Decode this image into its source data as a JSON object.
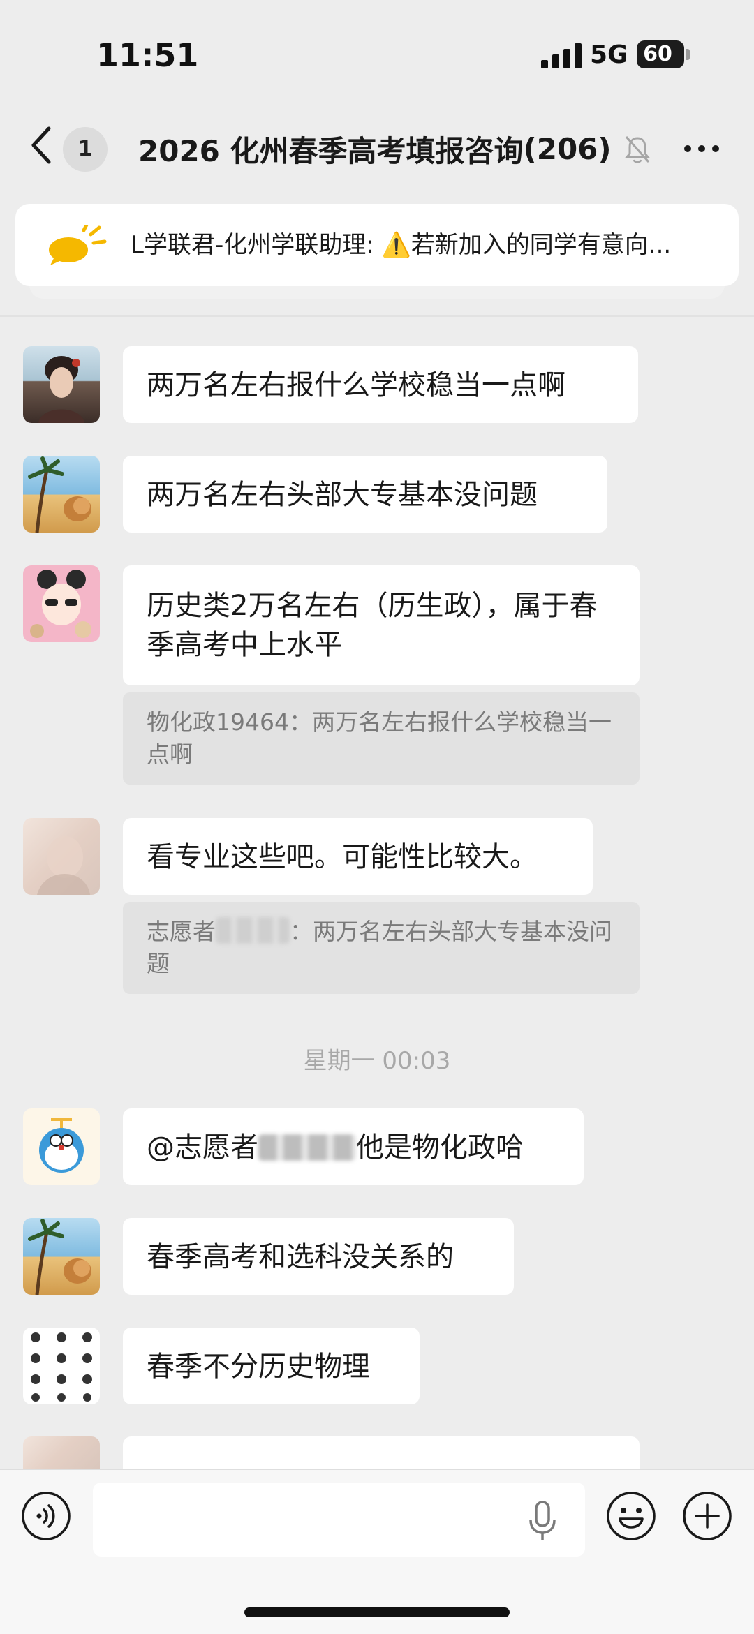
{
  "status_bar": {
    "time": "11:51",
    "network": "5G",
    "battery": "60"
  },
  "header": {
    "unread_count": "1",
    "title": "2026 化州春季高考填报咨询",
    "member_count": "(206)"
  },
  "pinned_notice": {
    "text": "L学联君-化州学联助理: ⚠️若新加入的同学有意向..."
  },
  "messages": [
    {
      "id": "m1",
      "text": "两万名左右报什么学校稳当一点啊"
    },
    {
      "id": "m2",
      "text": "两万名左右头部大专基本没问题"
    },
    {
      "id": "m3",
      "text": "历史类2万名左右（历生政），属于春季高考中上水平",
      "quote": "物化政19464：两万名左右报什么学校稳当一点啊"
    },
    {
      "id": "m4",
      "text": "看专业这些吧。可能性比较大。",
      "quote_prefix": "志愿者",
      "quote_suffix": "：两万名左右头部大专基本没问题"
    },
    {
      "id": "m5",
      "text_prefix": "@志愿者",
      "text_suffix": "他是物化政哈"
    },
    {
      "id": "m6",
      "text": "春季高考和选科没关系的"
    },
    {
      "id": "m7",
      "text": "春季不分历史物理"
    }
  ],
  "timestamp": "星期一 00:03",
  "input_bar": {
    "placeholder": ""
  },
  "icons": {
    "back": "chevron-left-icon",
    "mute": "bell-slash-icon",
    "more": "more-dots-icon",
    "notice": "megaphone-icon",
    "warning": "warning-icon",
    "voice": "voice-mode-icon",
    "mic": "microphone-icon",
    "emoji": "emoji-icon",
    "plus": "plus-icon"
  },
  "colors": {
    "background": "#ededed",
    "bubble": "#ffffff",
    "quote": "#e2e2e2",
    "notice_icon": "#f5b800"
  }
}
